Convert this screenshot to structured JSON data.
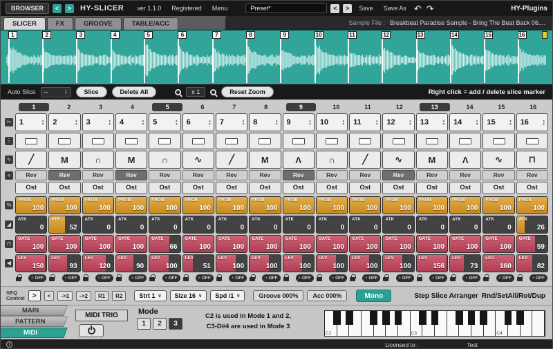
{
  "colors": {
    "accent": "#2ba093",
    "wave_bg": "#31a59a",
    "wave_line": "#cdeeea",
    "prob_fill": "#d79a2e",
    "gate_fill": "#c14f63",
    "lev_fill": "#c14f63",
    "dark": "#191919"
  },
  "header": {
    "browser": "BROWSER",
    "prev": "<",
    "next": ">",
    "title": "HY-SLICER",
    "version": "ver 1.1.0",
    "registered": "Registered",
    "menu": "Menu",
    "preset": "Preset*",
    "preset_prev": "<",
    "preset_next": ">",
    "save": "Save",
    "save_as": "Save As",
    "brand": "HY-Plugins"
  },
  "icons": {
    "undo": "↶",
    "redo": "↷",
    "chevron": "∨",
    "up": "▲",
    "down": "▼",
    "info": "i",
    "dot": "●"
  },
  "tabs": {
    "items": [
      "SLICER",
      "FX",
      "GROOVE",
      "TABLE/ACC"
    ],
    "active": "SLICER",
    "sample_label": "Sample File :",
    "sample_file": "Breakbeat Paradise Sample - Bring The Beat Back 06...."
  },
  "wave": {
    "markers": [
      {
        "label": "1",
        "pos": 0.5
      },
      {
        "label": "2",
        "pos": 6.8
      },
      {
        "label": "3",
        "pos": 13.1
      },
      {
        "label": "4",
        "pos": 19.4
      },
      {
        "label": "5",
        "pos": 25.6
      },
      {
        "label": "6",
        "pos": 31.9
      },
      {
        "label": "7",
        "pos": 38.2
      },
      {
        "label": "8",
        "pos": 44.5
      },
      {
        "label": "9",
        "pos": 50.8
      },
      {
        "label": "10",
        "pos": 57.1
      },
      {
        "label": "11",
        "pos": 63.3
      },
      {
        "label": "12",
        "pos": 69.6
      },
      {
        "label": "13",
        "pos": 75.9
      },
      {
        "label": "14",
        "pos": 82.2
      },
      {
        "label": "15",
        "pos": 88.5
      },
      {
        "label": "16",
        "pos": 94.7
      }
    ],
    "end_pos": 99.2
  },
  "wave_toolbar": {
    "auto_slice": "Auto Slice",
    "auto_value": "--",
    "slice": "Slice",
    "delete_all": "Delete All",
    "zoom_factor": "x 1",
    "reset_zoom": "Reset Zoom",
    "hint": "Right click = add / delete slice marker"
  },
  "grid": {
    "col_numbers": [
      "1",
      "2",
      "3",
      "4",
      "5",
      "6",
      "7",
      "8",
      "9",
      "10",
      "11",
      "12",
      "13",
      "14",
      "15",
      "16"
    ],
    "accent_cols": [
      1,
      5,
      9,
      13
    ],
    "slice_select": [
      "1",
      "2",
      "3",
      "4",
      "5",
      "6",
      "7",
      "8",
      "9",
      "10",
      "11",
      "12",
      "13",
      "14",
      "15",
      "16"
    ],
    "envelope_shapes": [
      "╱",
      "M",
      "∩",
      "M",
      "∩",
      "∿",
      "╱",
      "M",
      "Λ",
      "∩",
      "╱",
      "∿",
      "M",
      "Λ",
      "∿",
      "⊓"
    ],
    "rev_label": "Rev",
    "rev_active": [
      2,
      4,
      9,
      12
    ],
    "ost_label": "Ost",
    "prob": {
      "label": "PROB",
      "values": [
        100,
        100,
        100,
        100,
        100,
        100,
        100,
        100,
        100,
        100,
        100,
        100,
        100,
        100,
        100,
        100
      ]
    },
    "atk": {
      "label": "ATK",
      "values": [
        0,
        52,
        0,
        0,
        0,
        0,
        0,
        0,
        0,
        0,
        0,
        0,
        0,
        0,
        0,
        26
      ]
    },
    "gate": {
      "label": "GATE",
      "values": [
        100,
        100,
        100,
        100,
        66,
        100,
        100,
        100,
        100,
        100,
        100,
        100,
        100,
        100,
        100,
        59
      ]
    },
    "lev": {
      "label": "LEV",
      "values": [
        150,
        93,
        120,
        90,
        100,
        51,
        100,
        100,
        100,
        100,
        100,
        100,
        156,
        73,
        160,
        82
      ]
    },
    "off_label": "OFF",
    "gutter_icons": {
      "slice": "✂",
      "pan": "⋮",
      "env": "∿",
      "rev": "«",
      "prob": "%",
      "atk": "◢",
      "gate": "⊓",
      "lev": "◀"
    }
  },
  "seq": {
    "label1": "SEQ",
    "label2": "Control",
    "dir": ">",
    "step_back": "<",
    "btn_to1": "->1",
    "btn_to2": "->2",
    "btn_r1": "R1",
    "btn_r2": "R2",
    "start": "Strt 1",
    "size": "Size 16",
    "speed": "Spd /1",
    "groove": "Groove 000%",
    "acc": "Acc 000%",
    "mono": "Mono",
    "arranger": "Step Slice Arranger",
    "rnd": "Rnd/SetAll/Rot/Dup"
  },
  "side_tabs": {
    "items": [
      "MAIN",
      "PATTERN",
      "MIDI"
    ],
    "active": "MIDI"
  },
  "midi": {
    "trig": "MIDI TRIG",
    "mode": "Mode",
    "modes": [
      "1",
      "2",
      "3"
    ],
    "active_mode": "3",
    "info1": "C2 is used in Mode 1 and 2,",
    "info2": "C3-D#4 are used in Mode 3",
    "key_labels": [
      "C2",
      "C3",
      "C4"
    ]
  },
  "statusbar": {
    "licensed": "Licensed to :",
    "name": "Test"
  }
}
